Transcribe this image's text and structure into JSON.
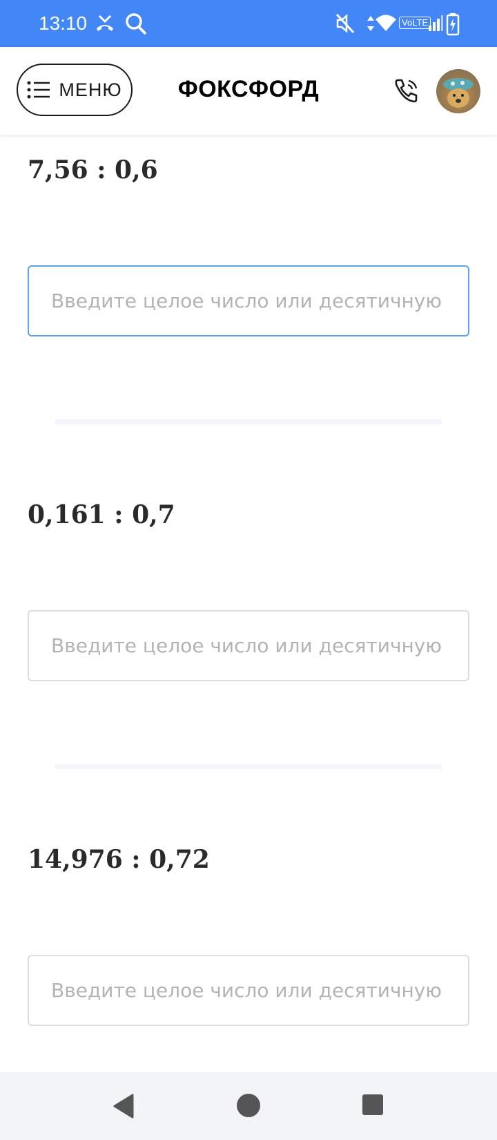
{
  "status_bar": {
    "time": "13:10",
    "volte": "VoLTE",
    "icons": [
      "missed-call-icon",
      "search-icon",
      "mute-icon",
      "data-arrows-icon",
      "wifi-icon",
      "signal-icon",
      "battery-charging-icon"
    ],
    "background": "#4287f5"
  },
  "header": {
    "menu_label": "МЕНЮ",
    "brand": "ФОКСФОРД",
    "icons": [
      "menu-list-icon",
      "phone-call-icon",
      "avatar"
    ]
  },
  "problems": [
    {
      "expression": "7,56 : 0,6",
      "input_value": "",
      "placeholder": "Введите целое число или десятичную др",
      "focused": true
    },
    {
      "expression": "0,161 : 0,7",
      "input_value": "",
      "placeholder": "Введите целое число или десятичную др",
      "focused": false
    },
    {
      "expression": "14,976 : 0,72",
      "input_value": "",
      "placeholder": "Введите целое число или десятичную др",
      "focused": false
    }
  ],
  "nav_bar": {
    "icons": [
      "back-icon",
      "home-icon",
      "recents-icon"
    ]
  },
  "colors": {
    "accent": "#4287f5",
    "focus_border": "#5aa3e6",
    "input_border": "#dcdcdc",
    "divider": "#f5f6fa"
  }
}
